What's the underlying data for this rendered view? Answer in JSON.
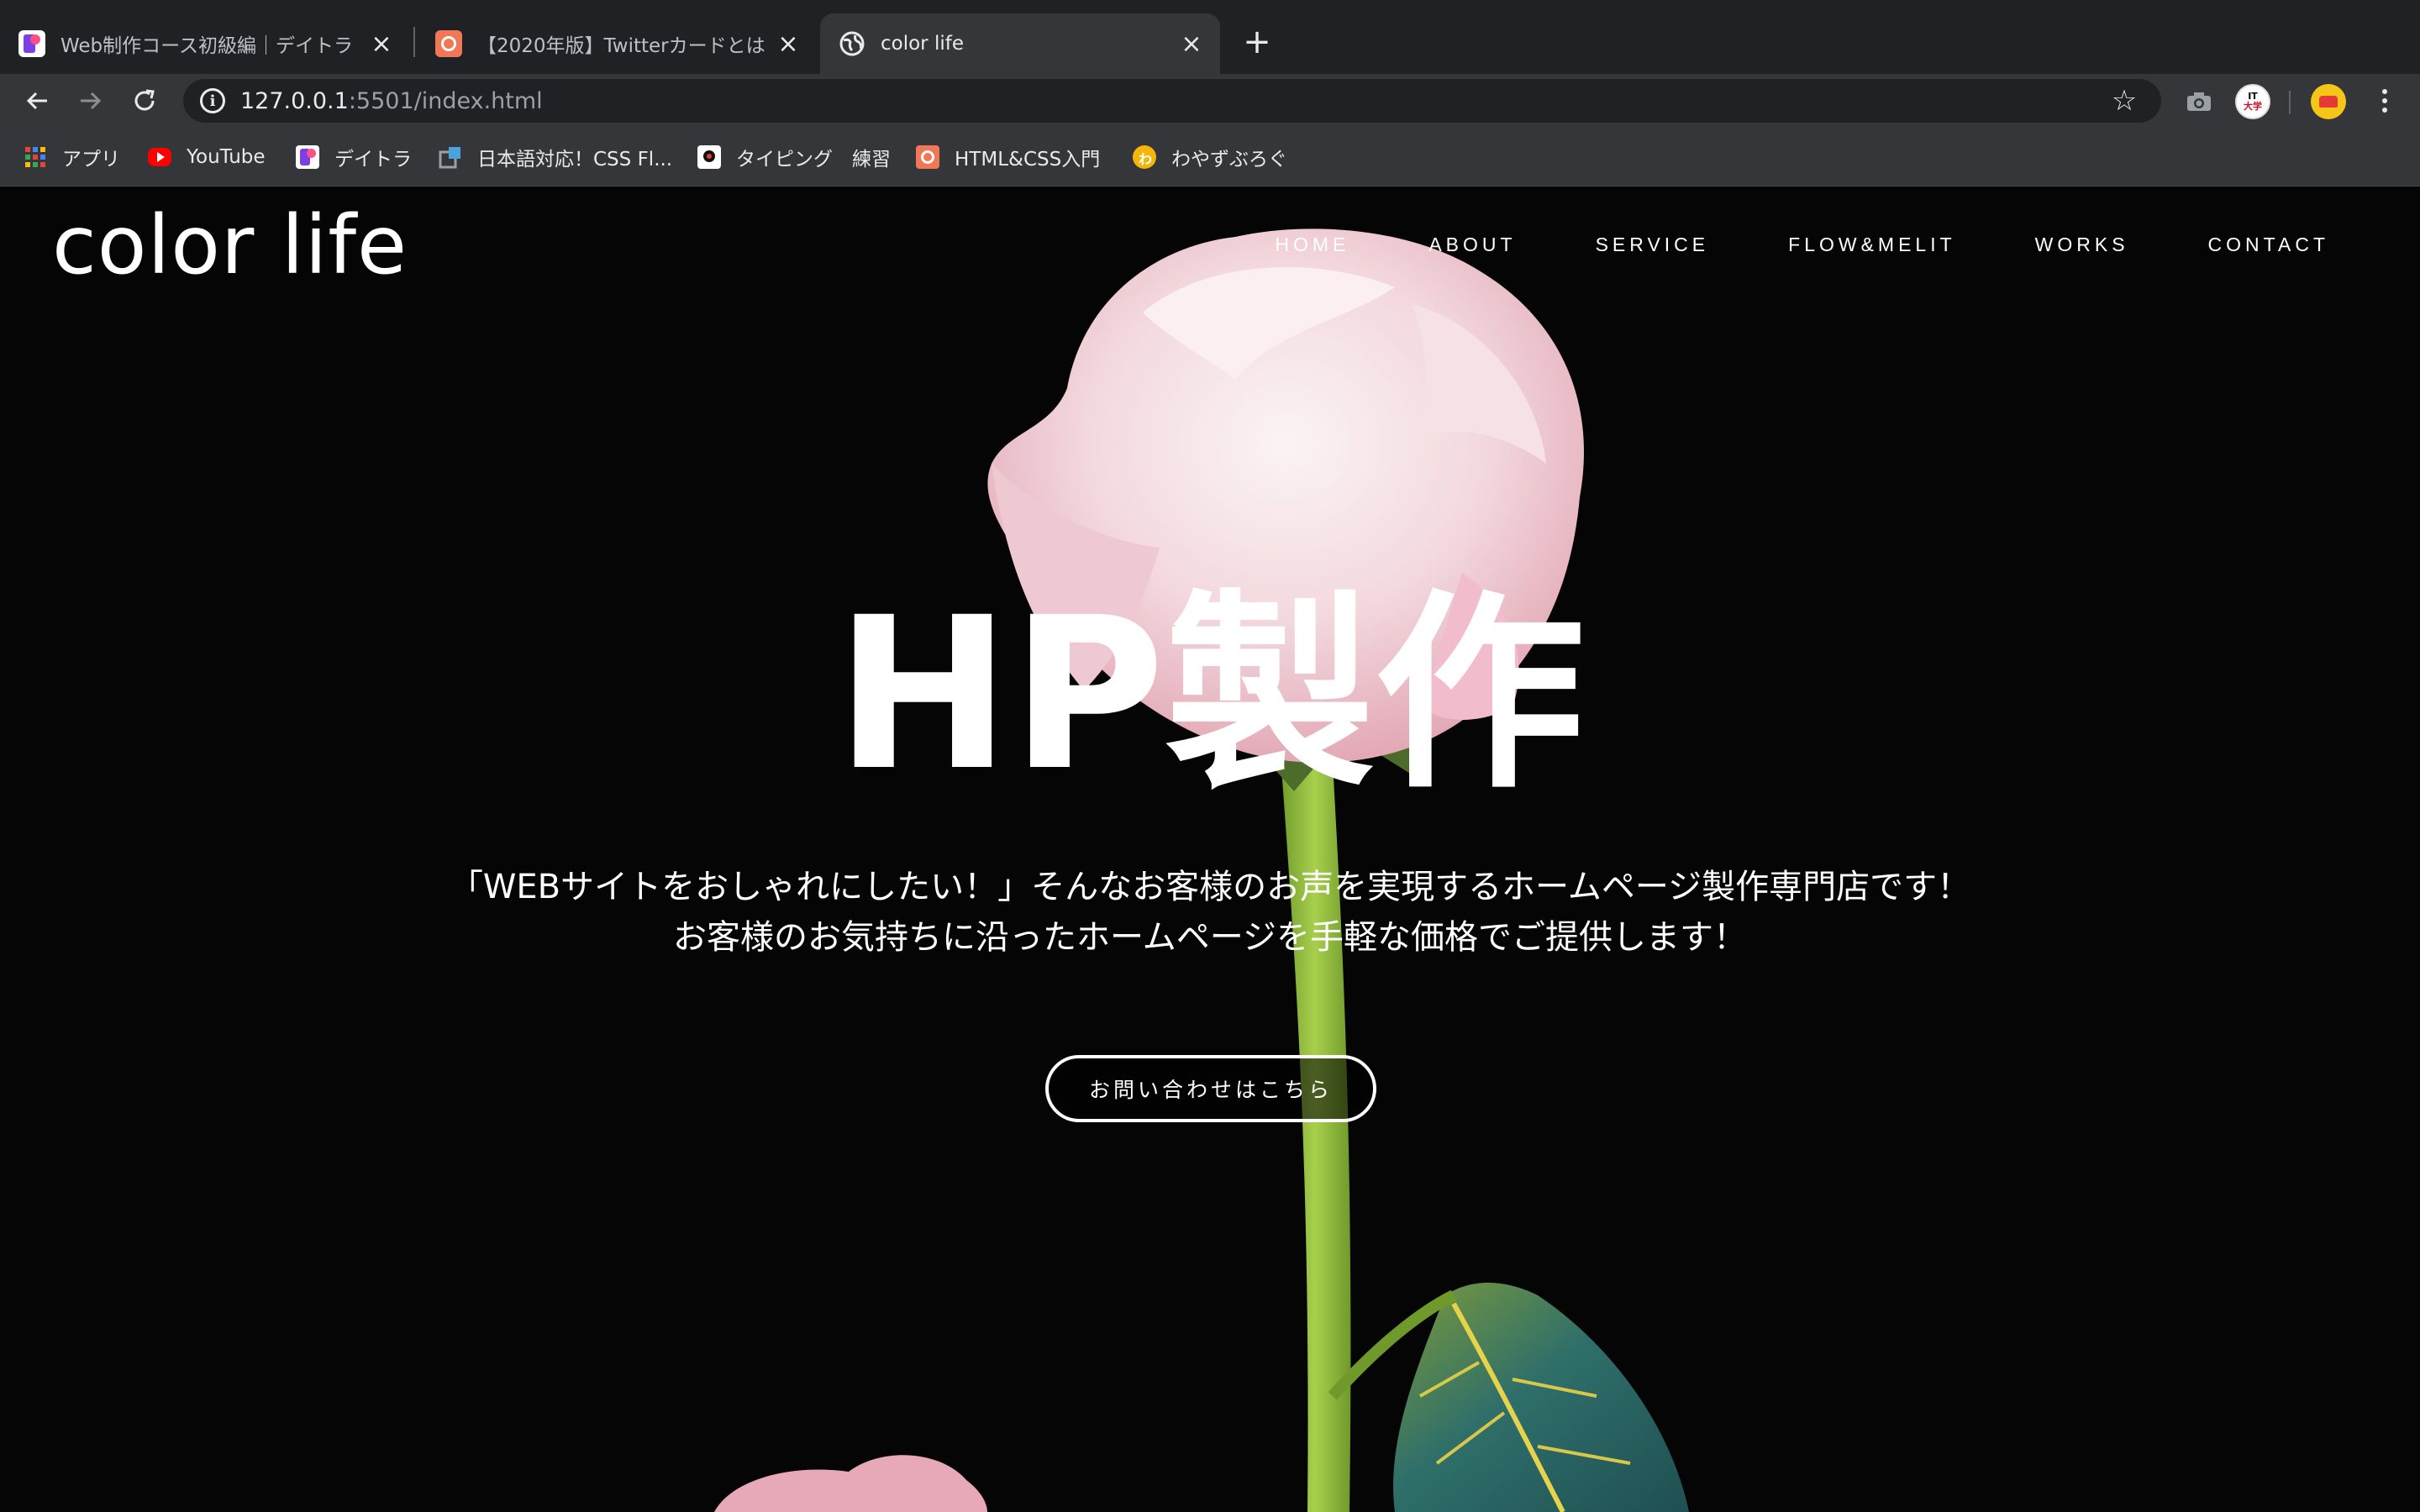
{
  "browser": {
    "tabs": [
      {
        "title": "Web制作コース初級編｜デイトラ",
        "favicon": "daytra-icon",
        "active": false
      },
      {
        "title": "【2020年版】Twitterカードとは？",
        "favicon": "orange-site-icon",
        "active": false
      },
      {
        "title": "color life",
        "favicon": "globe-icon",
        "active": true
      }
    ],
    "url_host": "127.0.0.1",
    "url_path": ":5501/index.html",
    "bookmarks": [
      {
        "label": "アプリ",
        "icon": "apps-grid-icon"
      },
      {
        "label": "YouTube",
        "icon": "youtube-icon"
      },
      {
        "label": "デイトラ",
        "icon": "daytra-icon"
      },
      {
        "label": "日本語対応！CSS Fl...",
        "icon": "css-flex-icon"
      },
      {
        "label": "タイピング　練習",
        "icon": "typing-icon"
      },
      {
        "label": "HTML&CSS入門",
        "icon": "html-css-icon"
      },
      {
        "label": "わやずぶろぐ",
        "icon": "wayazu-icon"
      }
    ],
    "extensions": {
      "it_badge": "IT\n大学"
    }
  },
  "site": {
    "logo": "color life",
    "nav": [
      "HOME",
      "ABOUT",
      "SERVICE",
      "FLOW&MELIT",
      "WORKS",
      "CONTACT"
    ],
    "hero_title": "HP製作",
    "hero_line1": "「WEBサイトをおしゃれにしたい！」そんなお客様のお声を実現するホームページ製作専門店です！",
    "hero_line2": "お客様のお気持ちに沿ったホームページを手軽な価格でご提供します！",
    "cta_label": "お問い合わせはこちら"
  },
  "colors": {
    "chrome_dark": "#202124",
    "chrome_toolbar": "#35363a",
    "page_bg": "#050505",
    "rose_pink": "#f3d6dc",
    "stem_green": "#8fbf3a",
    "leaf_teal": "#2f6f6a"
  }
}
